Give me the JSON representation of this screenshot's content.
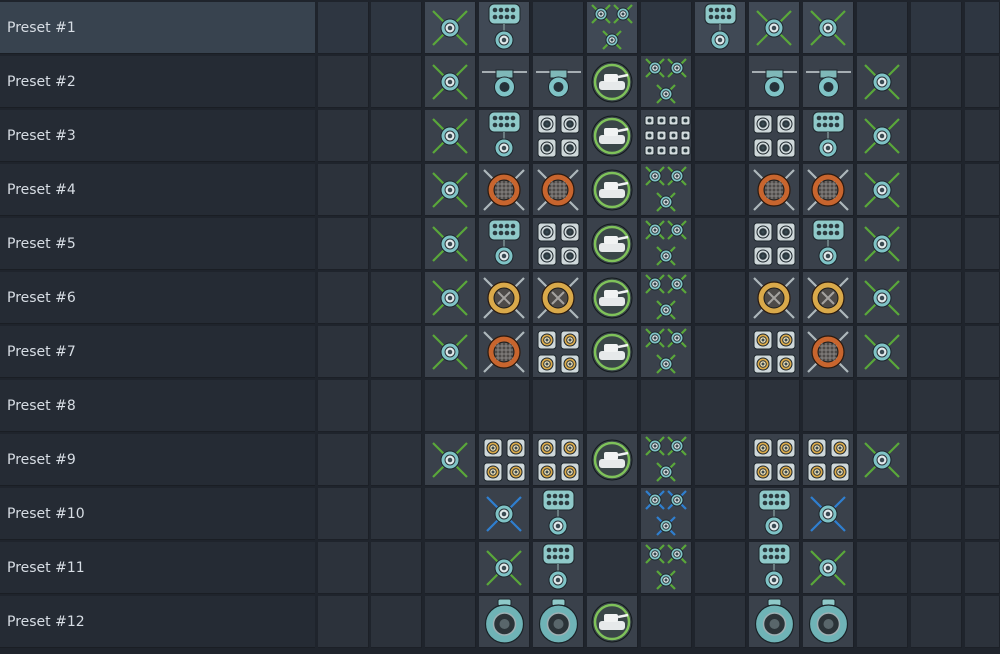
{
  "presets": [
    {
      "label": "Preset #1",
      "selected": true,
      "slots": [
        "",
        "",
        "bomb-green",
        "rocket-pod",
        "",
        "mg-triple",
        "",
        "rocket-pod",
        "bomb-green",
        "bomb-green",
        "",
        ""
      ]
    },
    {
      "label": "Preset #2",
      "selected": false,
      "slots": [
        "",
        "",
        "bomb-green",
        "gun-pod",
        "gun-pod",
        "tank-target",
        "mg-triple",
        "",
        "gun-pod",
        "gun-pod",
        "bomb-green",
        ""
      ]
    },
    {
      "label": "Preset #3",
      "selected": false,
      "slots": [
        "",
        "",
        "bomb-green",
        "rocket-pod",
        "mine-quad",
        "tank-target",
        "mine-grid",
        "",
        "mine-quad",
        "rocket-pod",
        "bomb-green",
        ""
      ]
    },
    {
      "label": "Preset #4",
      "selected": false,
      "slots": [
        "",
        "",
        "bomb-green",
        "orange-grid",
        "orange-grid",
        "tank-target",
        "mg-triple",
        "",
        "orange-grid",
        "orange-grid",
        "bomb-green",
        ""
      ]
    },
    {
      "label": "Preset #5",
      "selected": false,
      "slots": [
        "",
        "",
        "bomb-green",
        "rocket-pod",
        "mine-quad",
        "tank-target",
        "mg-triple",
        "",
        "mine-quad",
        "rocket-pod",
        "bomb-green",
        ""
      ]
    },
    {
      "label": "Preset #6",
      "selected": false,
      "slots": [
        "",
        "",
        "bomb-green",
        "orange-x",
        "orange-x",
        "tank-target",
        "mg-triple",
        "",
        "orange-x",
        "orange-x",
        "bomb-green",
        ""
      ]
    },
    {
      "label": "Preset #7",
      "selected": false,
      "slots": [
        "",
        "",
        "bomb-green",
        "orange-grid",
        "gold-quad",
        "tank-target",
        "mg-triple",
        "",
        "gold-quad",
        "orange-grid",
        "bomb-green",
        ""
      ]
    },
    {
      "label": "Preset #8",
      "selected": false,
      "slots": [
        "",
        "",
        "",
        "",
        "",
        "",
        "",
        "",
        "",
        "",
        "",
        ""
      ]
    },
    {
      "label": "Preset #9",
      "selected": false,
      "slots": [
        "",
        "",
        "bomb-green",
        "gold-quad",
        "gold-quad",
        "tank-target",
        "mg-triple",
        "",
        "gold-quad",
        "gold-quad",
        "bomb-green",
        ""
      ]
    },
    {
      "label": "Preset #10",
      "selected": false,
      "slots": [
        "",
        "",
        "",
        "bomb-blue",
        "rocket-pod",
        "",
        "mg-triple-blue",
        "",
        "rocket-pod",
        "bomb-blue",
        "",
        ""
      ]
    },
    {
      "label": "Preset #11",
      "selected": false,
      "slots": [
        "",
        "",
        "",
        "bomb-green",
        "rocket-pod",
        "",
        "mg-triple",
        "",
        "rocket-pod",
        "bomb-green",
        "",
        ""
      ]
    },
    {
      "label": "Preset #12",
      "selected": false,
      "slots": [
        "",
        "",
        "",
        "teal-big",
        "teal-big",
        "tank-target",
        "",
        "",
        "teal-big",
        "teal-big",
        "",
        ""
      ]
    }
  ],
  "colors": {
    "cross_green": "#5aa83a",
    "cross_blue": "#2f7fd0",
    "ordnance_teal": "#7fc3c6",
    "ordnance_orange": "#c8652e",
    "ordnance_gold": "#d9a94a",
    "target_ring": "#7fc25a"
  }
}
